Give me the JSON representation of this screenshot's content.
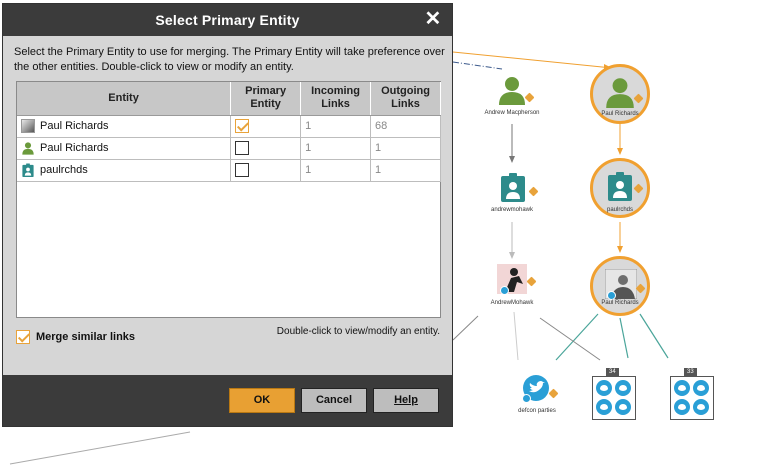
{
  "dialog": {
    "title": "Select Primary Entity",
    "close_label": "✕",
    "description": "Select the Primary Entity to use for merging. The Primary Entity will take preference over the other entities. Double-click to view or modify an entity.",
    "columns": {
      "entity": "Entity",
      "primary": "Primary Entity",
      "incoming": "Incoming Links",
      "outgoing": "Outgoing Links"
    },
    "rows": [
      {
        "icon": "person-photo-icon",
        "name": "Paul Richards",
        "primary": true,
        "incoming": "1",
        "outgoing": "68"
      },
      {
        "icon": "person-icon",
        "name": "Paul Richards",
        "primary": false,
        "incoming": "1",
        "outgoing": "1"
      },
      {
        "icon": "alias-badge-icon",
        "name": "paulrchds",
        "primary": false,
        "incoming": "1",
        "outgoing": "1"
      }
    ],
    "merge_label": "Merge similar links",
    "merge_checked": true,
    "hint": "Double-click to view/modify an entity.",
    "buttons": {
      "ok": "OK",
      "cancel": "Cancel",
      "help": "Help"
    }
  },
  "graph": {
    "nodes": {
      "andrew_macpherson": "Andrew Macpherson",
      "paul_richards_top": "Paul Richards",
      "andrewmohawk_alias": "andrewmohawk",
      "paulrchds_alias": "paulrchds",
      "andrewmohawk_photo": "AndrewMohawk",
      "paul_richards_photo": "Paul Richards",
      "defcon_parties": "defcon parties"
    },
    "group_counts": [
      "34",
      "33"
    ]
  },
  "colors": {
    "accent": "#e8a33b",
    "titlebar": "#3b3b3b",
    "person_green": "#6b9a3c",
    "alias_teal": "#2d8b8b",
    "twitter_blue": "#2a9fd6",
    "link_teal": "#4aa59a"
  }
}
